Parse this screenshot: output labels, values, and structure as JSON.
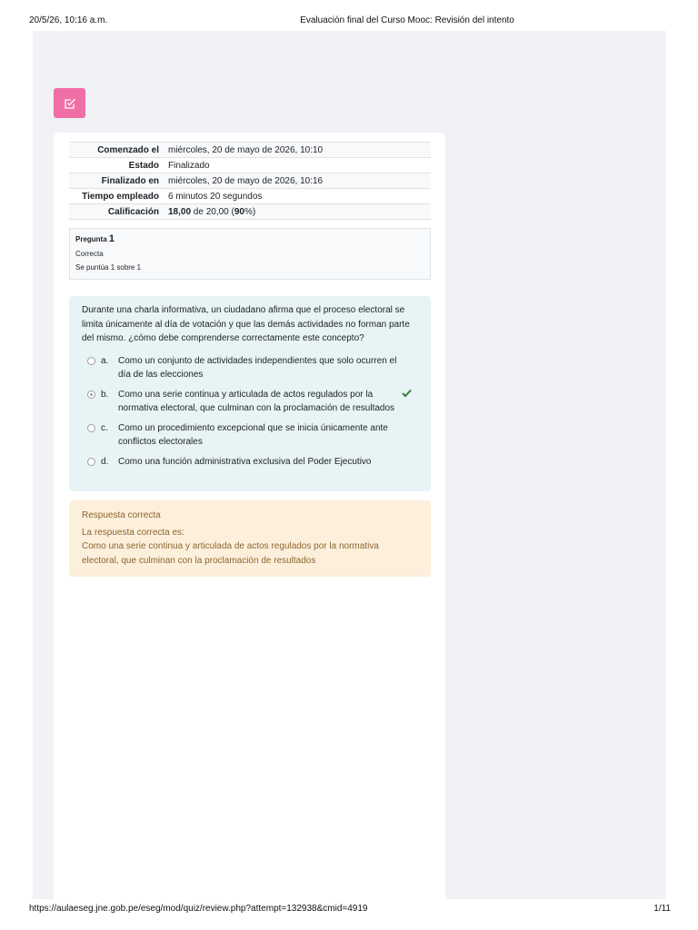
{
  "print_header": {
    "date": "20/5/26, 10:16 a.m.",
    "title": "Evaluación final del Curso Mooc: Revisión del intento"
  },
  "print_footer": {
    "url": "https://aulaeseg.jne.gob.pe/eseg/mod/quiz/review.php?attempt=132938&cmid=4919",
    "page": "1/11"
  },
  "quiz_icon": {
    "icon": "quiz-icon",
    "color": "#f06fa6"
  },
  "summary": {
    "rows": [
      {
        "label": "Comenzado el",
        "value": "miércoles, 20 de mayo de 2026, 10:10"
      },
      {
        "label": "Estado",
        "value": "Finalizado"
      },
      {
        "label": "Finalizado en",
        "value": "miércoles, 20 de mayo de 2026, 10:16"
      },
      {
        "label": "Tiempo empleado",
        "value": "6 minutos 20 segundos"
      }
    ],
    "grade": {
      "label": "Calificación",
      "score": "18,00",
      "rest": " de 20,00 (",
      "percent": "90",
      "suffix": "%)"
    }
  },
  "question_info": {
    "label": "Pregunta",
    "number": "1",
    "state": "Correcta",
    "grade": "Se puntúa 1 sobre 1"
  },
  "question": {
    "text": "Durante una charla informativa, un ciudadano afirma que el proceso electoral se limita únicamente al día de votación y que las demás actividades no forman parte del mismo. ¿cómo debe comprenderse correctamente este concepto?",
    "answers": [
      {
        "letter": "a.",
        "text": "Como un conjunto de actividades independientes que solo ocurren el día de las elecciones",
        "selected": false,
        "correct": false
      },
      {
        "letter": "b.",
        "text": "Como una serie continua y articulada de actos regulados por la normativa electoral, que culminan con la proclamación de resultados",
        "selected": true,
        "correct": true
      },
      {
        "letter": "c.",
        "text": "Como un procedimiento excepcional que se inicia únicamente ante conflictos electorales",
        "selected": false,
        "correct": false
      },
      {
        "letter": "d.",
        "text": "Como una función administrativa exclusiva del Poder Ejecutivo",
        "selected": false,
        "correct": false
      }
    ]
  },
  "feedback": {
    "line1": "Respuesta correcta",
    "line2": "La respuesta correcta es:",
    "line3": "Como una serie continua y articulada de actos regulados por la normativa electoral, que culminan con la proclamación de resultados"
  },
  "colors": {
    "canvas": "#f0f2f5",
    "formulation_bg": "#e7f3f5",
    "feedback_bg": "#fcefdc",
    "feedback_text": "#8e662e",
    "check": "#357a32"
  }
}
